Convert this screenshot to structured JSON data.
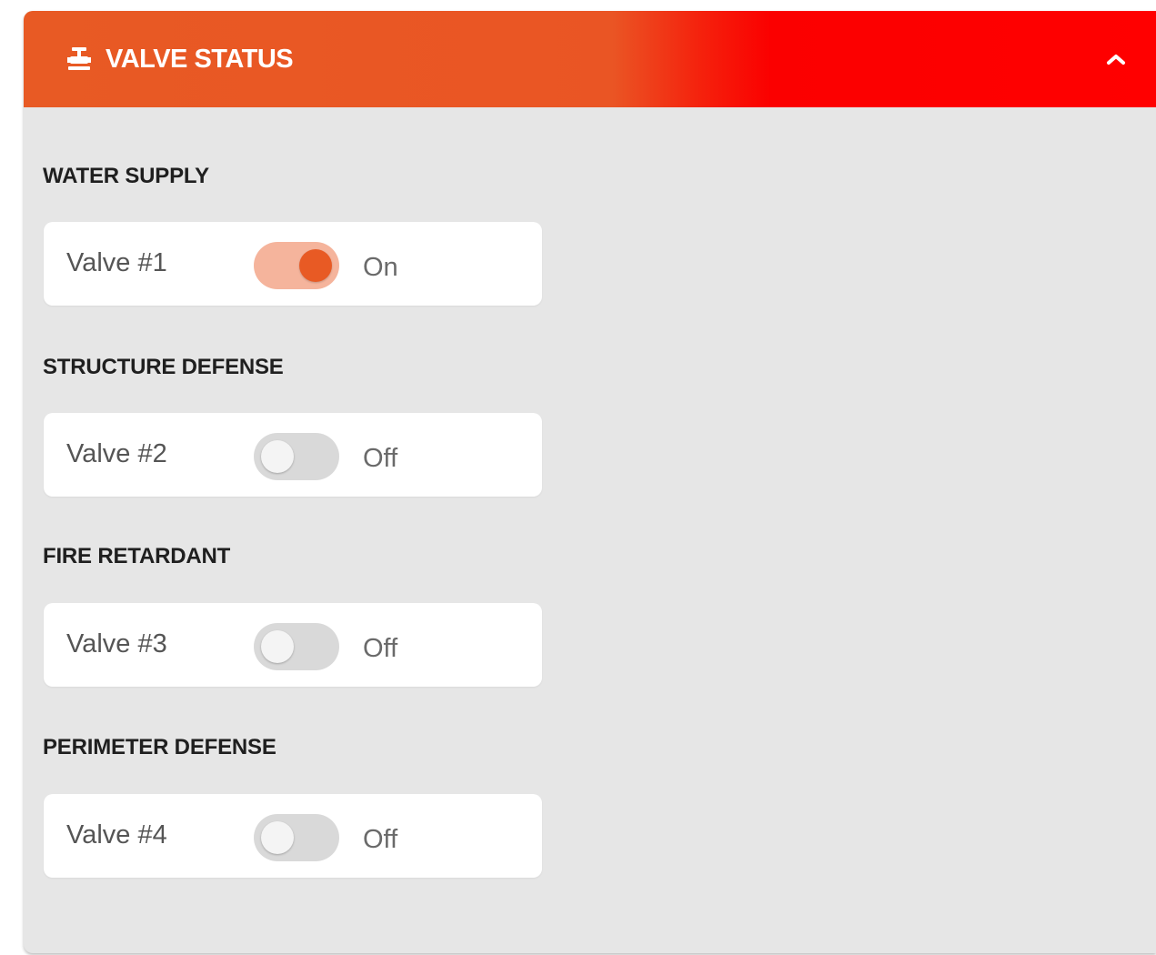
{
  "panel": {
    "title": "VALVE STATUS",
    "header_icon": "valve-icon",
    "collapse_icon": "chevron-up-icon",
    "accent_color": "#e85a24",
    "gradient_end_color": "#ff0000"
  },
  "sections": [
    {
      "label": "WATER SUPPLY",
      "valve": {
        "name": "Valve #1",
        "state": "On",
        "on": true
      }
    },
    {
      "label": "STRUCTURE DEFENSE",
      "valve": {
        "name": "Valve #2",
        "state": "Off",
        "on": false
      }
    },
    {
      "label": "FIRE RETARDANT",
      "valve": {
        "name": "Valve #3",
        "state": "Off",
        "on": false
      }
    },
    {
      "label": "PERIMETER DEFENSE",
      "valve": {
        "name": "Valve #4",
        "state": "Off",
        "on": false
      }
    }
  ]
}
